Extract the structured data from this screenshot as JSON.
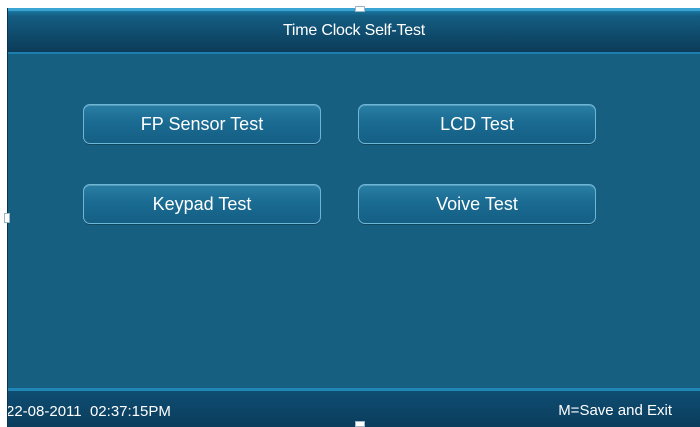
{
  "window": {
    "title": "Time Clock Self-Test"
  },
  "tests": [
    {
      "label": "FP Sensor Test"
    },
    {
      "label": "LCD Test"
    },
    {
      "label": "Keypad Test"
    },
    {
      "label": "Voive Test"
    }
  ],
  "status": {
    "date": "22-08-2011",
    "time": "02:37:15PM",
    "hint": "M=Save and Exit"
  },
  "colors": {
    "background": "#145d7e",
    "title_bar": "#0f4a6b",
    "button_border": "#6fb6d6",
    "text": "#ffffff"
  }
}
